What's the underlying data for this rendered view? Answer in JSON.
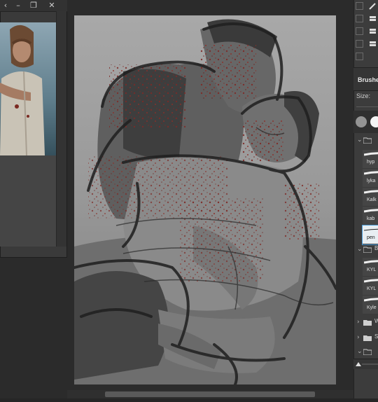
{
  "reference_window": {
    "minimize_glyph": "–",
    "restore_glyph": "❐",
    "close_glyph": "✕"
  },
  "brushes_panel": {
    "title": "Brushes",
    "size_label": "Size:",
    "folders": [
      {
        "label": "",
        "expanded": true
      },
      {
        "label": "B",
        "expanded": true
      },
      {
        "label": "W",
        "expanded": false
      },
      {
        "label": "S",
        "expanded": false
      },
      {
        "label": "",
        "expanded": true
      }
    ],
    "brushes": [
      {
        "label": "hyp",
        "selected": false
      },
      {
        "label": "lyka",
        "selected": false
      },
      {
        "label": "Kalk",
        "selected": false
      },
      {
        "label": "kab",
        "selected": false
      },
      {
        "label": "pen",
        "selected": true
      },
      {
        "label": "KYL",
        "selected": false
      },
      {
        "label": "KYL",
        "selected": false
      },
      {
        "label": "Kyle",
        "selected": false
      }
    ]
  },
  "colors": {
    "accent": "#4a9ad6",
    "panel_bg": "#3c3c3c",
    "app_bg": "#2b2b2b"
  }
}
